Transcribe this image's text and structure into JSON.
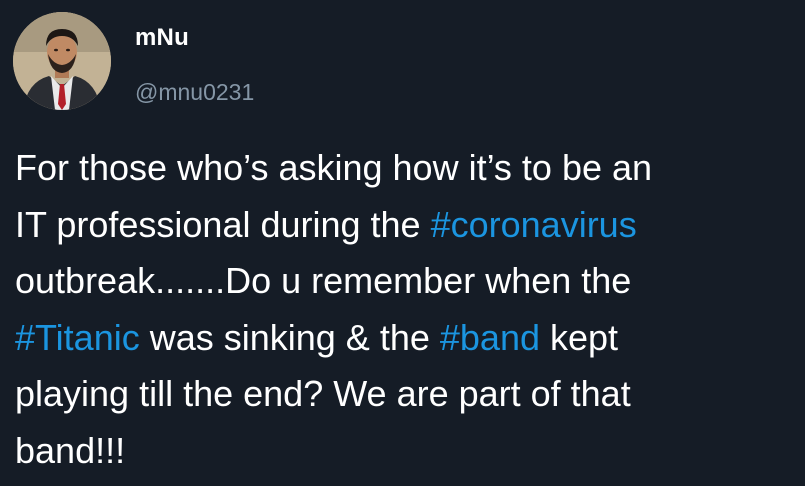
{
  "user": {
    "display_name": "mNu",
    "handle": "@mnu0231",
    "avatar_icon": "profile-photo-avatar"
  },
  "tweet": {
    "lines": [
      [
        {
          "text": "For those who’s asking how it’s to be an"
        }
      ],
      [
        {
          "text": "IT professional during the "
        },
        {
          "text": "#coronavirus",
          "hashtag": true
        }
      ],
      [
        {
          "text": "outbreak.......Do u remember when the"
        }
      ],
      [
        {
          "text": "#Titanic",
          "hashtag": true
        },
        {
          "text": " was sinking & the "
        },
        {
          "text": "#band",
          "hashtag": true
        },
        {
          "text": " kept"
        }
      ],
      [
        {
          "text": "playing till the end? We are part of that"
        }
      ],
      [
        {
          "text": "band!!!"
        }
      ]
    ]
  },
  "colors": {
    "background": "#151c26",
    "text": "#ffffff",
    "handle": "#8596a6",
    "hashtag": "#1b95e0"
  }
}
